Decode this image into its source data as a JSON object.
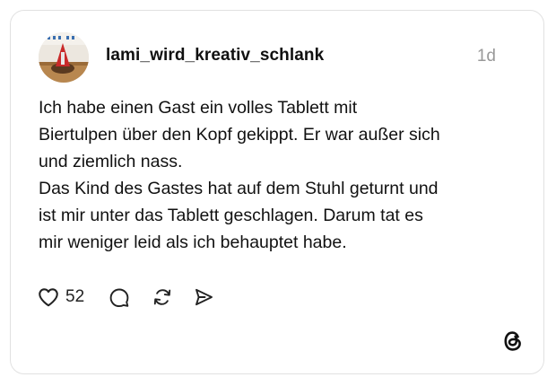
{
  "post": {
    "username": "lami_wird_kreativ_schlank",
    "timestamp": "1d",
    "lines": [
      "Ich habe einen Gast ein volles Tablett mit",
      "Biertulpen über den Kopf gekippt. Er war außer sich",
      "und ziemlich nass.",
      "Das Kind des Gastes hat auf dem Stuhl geturnt und",
      "ist mir unter das Tablett geschlagen. Darum tat es",
      "mir weniger leid als ich behauptet habe."
    ]
  },
  "actions": {
    "like_count": "52",
    "like_icon": "heart-icon",
    "comment_icon": "comment-icon",
    "repost_icon": "repost-icon",
    "share_icon": "send-icon"
  },
  "branding": {
    "logo_icon": "threads-logo-icon"
  },
  "colors": {
    "text": "#101010",
    "muted": "#999999",
    "border": "#e1e1e1"
  }
}
